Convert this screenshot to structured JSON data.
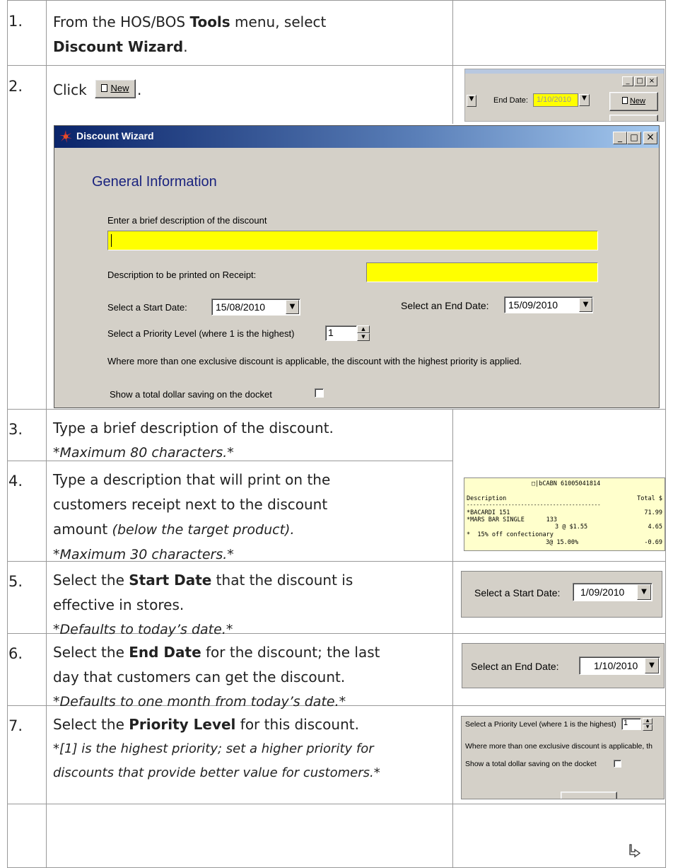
{
  "steps": [
    {
      "num": "1.",
      "pre": "From the HOS/BOS ",
      "bold": "Tools",
      "mid": " menu, select",
      "bold2": "Discount Wizard",
      "post": "."
    },
    {
      "num": "2.",
      "pre": "Click",
      "button_label": "New",
      "post": "."
    },
    {
      "num": "3.",
      "line1": "Type a brief description of the discount.",
      "note": "*Maximum 80 characters.*"
    },
    {
      "num": "4.",
      "line1": "Type a description that will print on the",
      "line2": "customers receipt next to the discount",
      "line3_plain": "amount ",
      "line3_ital": "(below the target product).",
      "note": "*Maximum 30 characters.*"
    },
    {
      "num": "5.",
      "pre": "Select the ",
      "bold": "Start Date",
      "post": " that the discount is",
      "line2": "effective in stores.",
      "note": "*Defaults to today’s date.*"
    },
    {
      "num": "6.",
      "pre": "Select the ",
      "bold": "End Date",
      "post": " for the discount; the last",
      "line2": "day that customers can get the discount.",
      "note": "*Defaults to one month from today’s date.*"
    },
    {
      "num": "7.",
      "pre": "Select the ",
      "bold": "Priority Level",
      "post": " for this discount.",
      "note1": "*[1] is the highest priority; set a higher priority for",
      "note2": "discounts that provide better value for customers.*"
    }
  ],
  "toolbar_crop": {
    "end_date_label": "End Date:",
    "end_date_value": "1/10/2010",
    "new_label": "New"
  },
  "wizard": {
    "title": "Discount Wizard",
    "heading": "General Information",
    "desc_label": "Enter a brief description of the discount",
    "receipt_label": "Description to be printed on Receipt:",
    "start_label": "Select a Start Date:",
    "start_value": "15/08/2010",
    "end_label": "Select an End Date:",
    "end_value": "15/09/2010",
    "priority_label": "Select a Priority Level (where 1 is the highest)",
    "priority_value": "1",
    "info": "Where more than one exclusive discount is applicable, the discount with the highest priority is applied.",
    "saving_label": "Show a total dollar saving on the docket"
  },
  "receipt": {
    "header": "□|bCABN 61005041814",
    "col_desc": "Description",
    "col_total": "Total $",
    "rule": "------------------------------------------",
    "l1": "*BACARDI 151",
    "l1v": "71.99",
    "l2": "*MARS BAR SINGLE      133",
    "l3": "3 @ $1.55",
    "l3v": "4.65",
    "l4": "*  15% off confectionary",
    "l5": "3@ 15.00%",
    "l5v": "-0.69"
  },
  "start_crop": {
    "label": "Select a Start Date:",
    "value": "1/09/2010"
  },
  "end_crop": {
    "label": "Select an End Date:",
    "value": "1/10/2010"
  },
  "priority_crop": {
    "label": "Select a Priority Level (where 1 is the highest)",
    "value": "1",
    "info": "Where more than one exclusive discount is applicable, th",
    "saving": "Show a total dollar saving on the docket"
  },
  "continue_icon": "continue-arrow-icon",
  "colors": {
    "title_bar": "#0a246a",
    "heading": "#1a237e",
    "field": "#ffff00",
    "window": "#d4d0c8"
  }
}
